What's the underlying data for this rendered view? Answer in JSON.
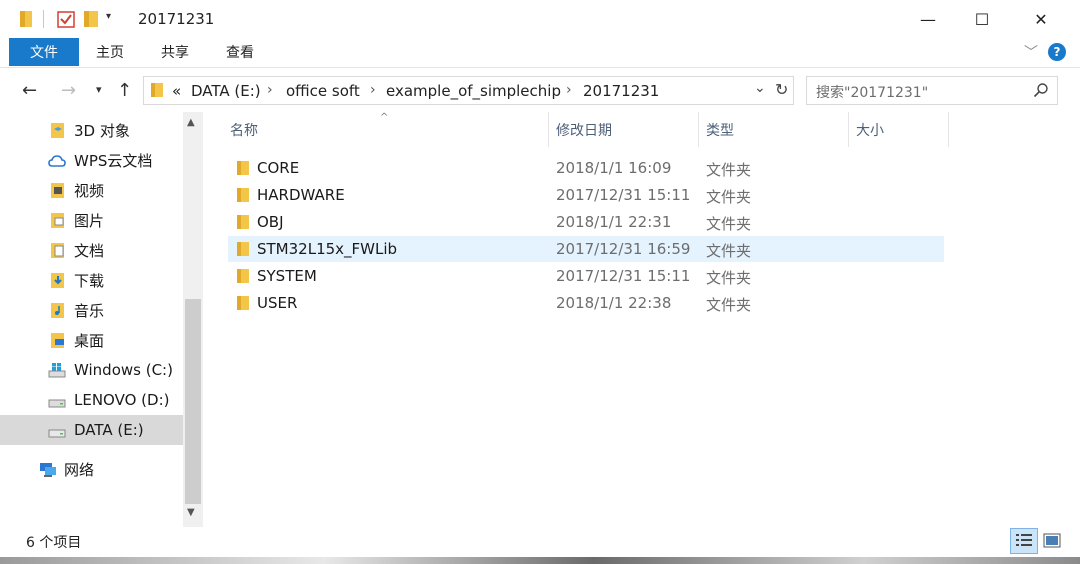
{
  "window": {
    "title": "20171231",
    "controls": {
      "minimize": "—",
      "maximize": "☐",
      "close": "✕"
    }
  },
  "ribbon": {
    "tabs": {
      "file": "文件",
      "home": "主页",
      "share": "共享",
      "view": "查看"
    },
    "help": "?"
  },
  "address": {
    "overflow": "«",
    "crumbs": [
      "DATA (E:)",
      "office soft",
      "example_of_simplechip",
      "20171231"
    ],
    "separator": "›"
  },
  "search": {
    "placeholder": "搜索\"20171231\""
  },
  "sidebar": {
    "items": [
      {
        "label": "3D 对象",
        "icon": "3d-objects-icon"
      },
      {
        "label": "WPS云文档",
        "icon": "cloud-icon"
      },
      {
        "label": "视频",
        "icon": "video-folder-icon"
      },
      {
        "label": "图片",
        "icon": "pictures-folder-icon"
      },
      {
        "label": "文档",
        "icon": "documents-folder-icon"
      },
      {
        "label": "下载",
        "icon": "downloads-folder-icon"
      },
      {
        "label": "音乐",
        "icon": "music-folder-icon"
      },
      {
        "label": "桌面",
        "icon": "desktop-folder-icon"
      },
      {
        "label": "Windows (C:)",
        "icon": "windows-drive-icon"
      },
      {
        "label": "LENOVO (D:)",
        "icon": "drive-icon"
      },
      {
        "label": "DATA (E:)",
        "icon": "drive-icon",
        "selected": true
      },
      {
        "label": "网络",
        "icon": "network-icon"
      }
    ]
  },
  "columns": {
    "name": "名称",
    "date": "修改日期",
    "type": "类型",
    "size": "大小"
  },
  "files": [
    {
      "name": "CORE",
      "date": "2018/1/1 16:09",
      "type": "文件夹"
    },
    {
      "name": "HARDWARE",
      "date": "2017/12/31 15:11",
      "type": "文件夹"
    },
    {
      "name": "OBJ",
      "date": "2018/1/1 22:31",
      "type": "文件夹"
    },
    {
      "name": "STM32L15x_FWLib",
      "date": "2017/12/31 16:59",
      "type": "文件夹",
      "hover": true
    },
    {
      "name": "SYSTEM",
      "date": "2017/12/31 15:11",
      "type": "文件夹"
    },
    {
      "name": "USER",
      "date": "2018/1/1 22:38",
      "type": "文件夹"
    }
  ],
  "status": {
    "item_count": "6 个项目"
  },
  "colors": {
    "accent": "#1979ca",
    "selection": "#d9d9d9",
    "hover": "#e5f3ff",
    "folder": "#f3c64a"
  }
}
